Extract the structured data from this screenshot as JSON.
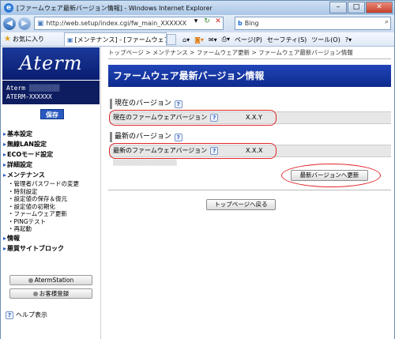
{
  "window": {
    "title": "[ファームウェア最新バージョン情報] - Windows Internet Explorer"
  },
  "browser": {
    "url": "http://web.setup/index.cgi/fw_main_XXXXXX",
    "search_engine": "Bing",
    "favorites_label": "お気に入り",
    "tab_label": "[メンテナンス] - [ファームウェア更...",
    "commands": [
      "ページ(P)",
      "セーフティ(S)",
      "ツール(O)"
    ]
  },
  "sidebar": {
    "logo_text": "Aterm",
    "model_line1": "Aterm",
    "model_line2": "ATERM-XXXXXX",
    "save_label": "保存",
    "menu": [
      {
        "label": "基本設定"
      },
      {
        "label": "無線LAN設定"
      },
      {
        "label": "ECOモード設定"
      },
      {
        "label": "詳細設定"
      },
      {
        "label": "メンテナンス"
      }
    ],
    "submenu": [
      "管理者パスワードの変更",
      "時刻設定",
      "設定値の保存＆復元",
      "設定値の初期化",
      "ファームウェア更新",
      "PINGテスト",
      "再起動"
    ],
    "menu2": [
      {
        "label": "情報"
      },
      {
        "label": "悪質サイトブロック"
      }
    ],
    "buttons": [
      "AtermStation",
      "お客様登録"
    ],
    "help_label": "ヘルプ表示"
  },
  "main": {
    "breadcrumb": "トップページ > メンテナンス > ファームウェア更新 > ファームウェア最新バージョン情報",
    "title": "ファームウェア最新バージョン情報",
    "current_section": "現在のバージョン",
    "current_label": "現在のファームウェアバージョン",
    "current_value": "X.X.Y",
    "latest_section": "最新のバージョン",
    "latest_label": "最新のファームウェアバージョン",
    "latest_value": "X.X.X",
    "update_button": "最新バージョンへ更新",
    "back_button": "トップページへ戻る"
  },
  "colors": {
    "header_bg": "#1a3aa8",
    "highlight": "#e0262a"
  }
}
